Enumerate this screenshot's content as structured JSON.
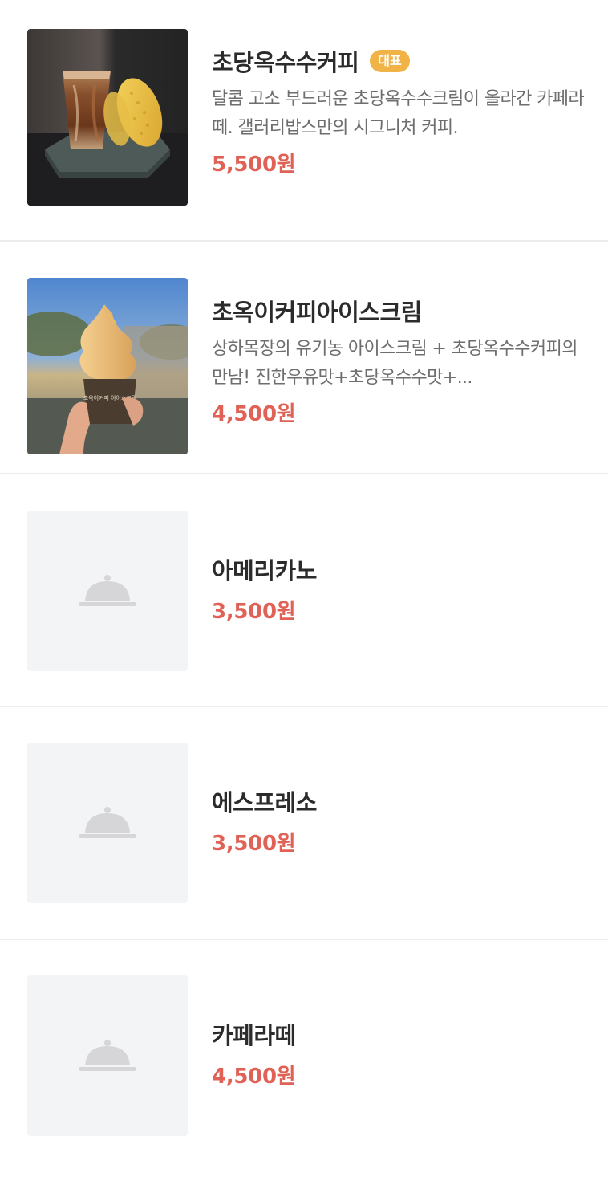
{
  "menu": {
    "items": [
      {
        "name": "초당옥수수커피",
        "badge": "대표",
        "description": "달콤 고소 부드러운 초당옥수수크림이 올라간 카페라떼. 갤러리밥스만의 시그니처 커피.",
        "price": "5,500원",
        "image": "corn-coffee-photo"
      },
      {
        "name": "초옥이커피아이스크림",
        "description": "상하목장의 유기농 아이스크림 + 초당옥수수커피의 만남! 진한우유맛+초당옥수수맛+...",
        "price": "4,500원",
        "image": "ice-cream-photo",
        "cup_text": "초옥이커피 아이스크림"
      },
      {
        "name": "아메리카노",
        "price": "3,500원",
        "image": "cloche-icon"
      },
      {
        "name": "에스프레소",
        "price": "3,500원",
        "image": "cloche-icon"
      },
      {
        "name": "카페라떼",
        "price": "4,500원",
        "image": "cloche-icon"
      }
    ]
  },
  "colors": {
    "price": "#e06256",
    "badge": "#f1b345",
    "placeholder_bg": "#f3f4f6",
    "divider": "#ececec"
  }
}
